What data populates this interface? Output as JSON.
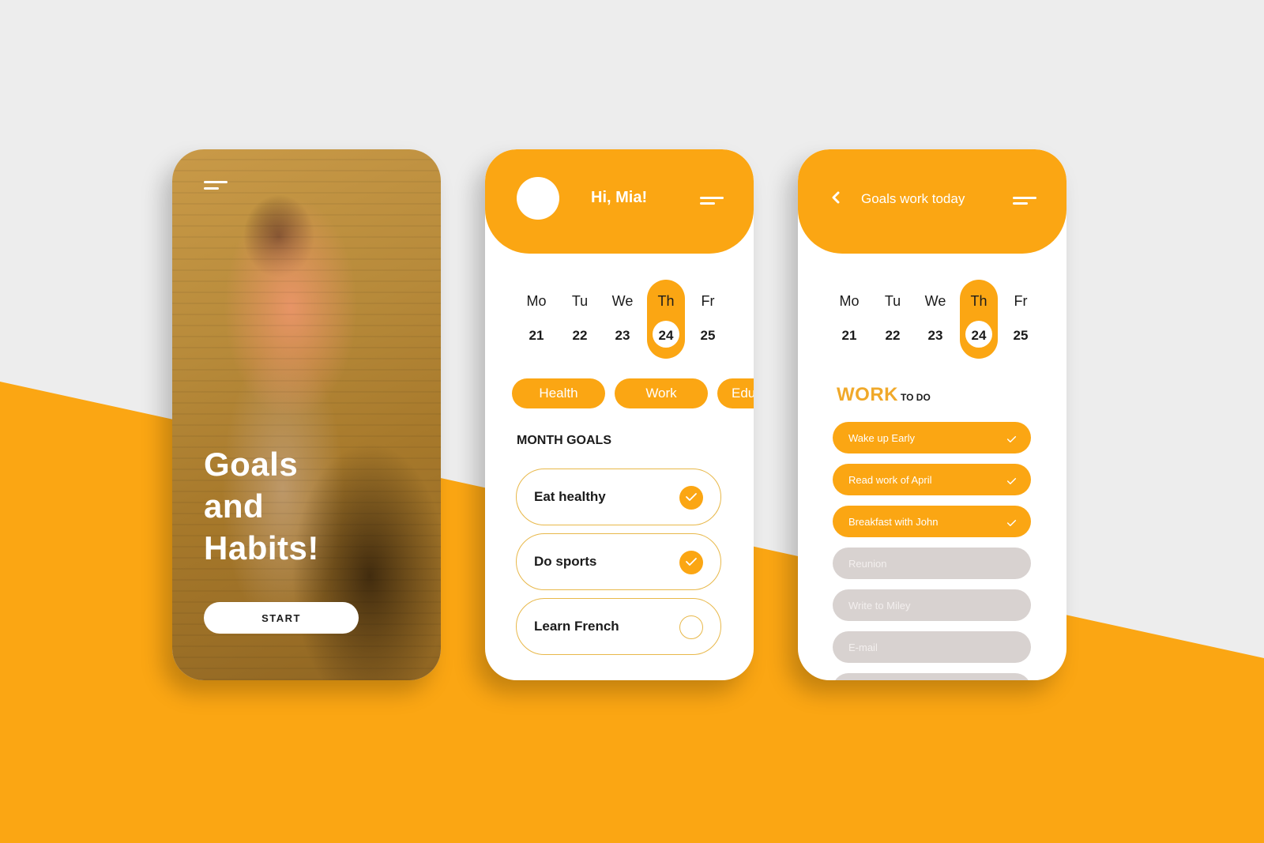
{
  "theme": {
    "accent": "#fba613",
    "background_top": "#ededed",
    "pending_gray": "#d8d2d0"
  },
  "screen1": {
    "menu_icon": "hamburger-menu-icon",
    "title_lines": [
      "Goals",
      "and",
      "Habits!"
    ],
    "start_label": "START"
  },
  "screen2": {
    "greeting": "Hi, Mia!",
    "menu_icon": "hamburger-menu-icon",
    "calendar": {
      "days": [
        {
          "name": "Mo",
          "num": "21"
        },
        {
          "name": "Tu",
          "num": "22"
        },
        {
          "name": "We",
          "num": "23"
        },
        {
          "name": "Th",
          "num": "24"
        },
        {
          "name": "Fr",
          "num": "25"
        }
      ],
      "selected": "Th"
    },
    "chips": [
      "Health",
      "Work",
      "Edu"
    ],
    "section_title": "MONTH GOALS",
    "goals": [
      {
        "label": "Eat healthy",
        "done": true
      },
      {
        "label": "Do sports",
        "done": true
      },
      {
        "label": "Learn French",
        "done": false
      }
    ]
  },
  "screen3": {
    "title": "Goals work today",
    "back_icon": "chevron-left-icon",
    "menu_icon": "hamburger-menu-icon",
    "calendar": {
      "days": [
        {
          "name": "Mo",
          "num": "21"
        },
        {
          "name": "Tu",
          "num": "22"
        },
        {
          "name": "We",
          "num": "23"
        },
        {
          "name": "Th",
          "num": "24"
        },
        {
          "name": "Fr",
          "num": "25"
        }
      ],
      "selected": "Th"
    },
    "work_title": "WORK",
    "work_subtitle": "TO DO",
    "tasks": [
      {
        "label": "Wake up Early",
        "done": true
      },
      {
        "label": "Read work of April",
        "done": true
      },
      {
        "label": "Breakfast with John",
        "done": true
      },
      {
        "label": "Reunion",
        "done": false
      },
      {
        "label": "Write to Miley",
        "done": false
      },
      {
        "label": "E-mail",
        "done": false
      },
      {
        "label": "",
        "done": false
      }
    ]
  }
}
